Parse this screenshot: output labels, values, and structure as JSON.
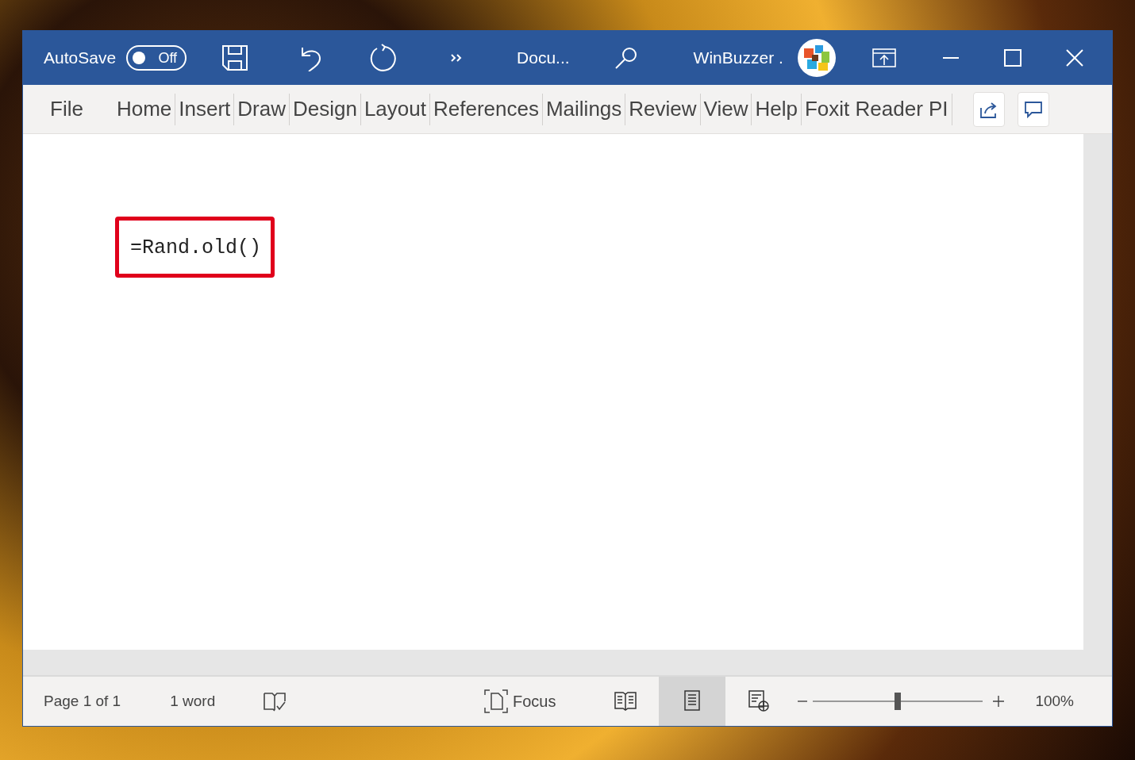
{
  "title_bar": {
    "autosave_label": "AutoSave",
    "autosave_toggle": {
      "label": "Off",
      "on": false
    },
    "document_title": "Docu...",
    "user_name": "WinBuzzer ."
  },
  "ribbon": {
    "tabs": [
      {
        "label": "File"
      },
      {
        "label": "Home"
      },
      {
        "label": "Insert"
      },
      {
        "label": "Draw"
      },
      {
        "label": "Design"
      },
      {
        "label": "Layout"
      },
      {
        "label": "References"
      },
      {
        "label": "Mailings"
      },
      {
        "label": "Review"
      },
      {
        "label": "View"
      },
      {
        "label": "Help"
      },
      {
        "label": "Foxit Reader PI"
      }
    ]
  },
  "document": {
    "text": "=Rand.old()",
    "highlighted": true
  },
  "status_bar": {
    "page": "Page 1 of 1",
    "words": "1 word",
    "focus": "Focus",
    "views": [
      {
        "kind": "read",
        "selected": false
      },
      {
        "kind": "print",
        "selected": true
      },
      {
        "kind": "web",
        "selected": false
      }
    ],
    "zoom": {
      "level": 0.5,
      "reading": "100%"
    }
  }
}
